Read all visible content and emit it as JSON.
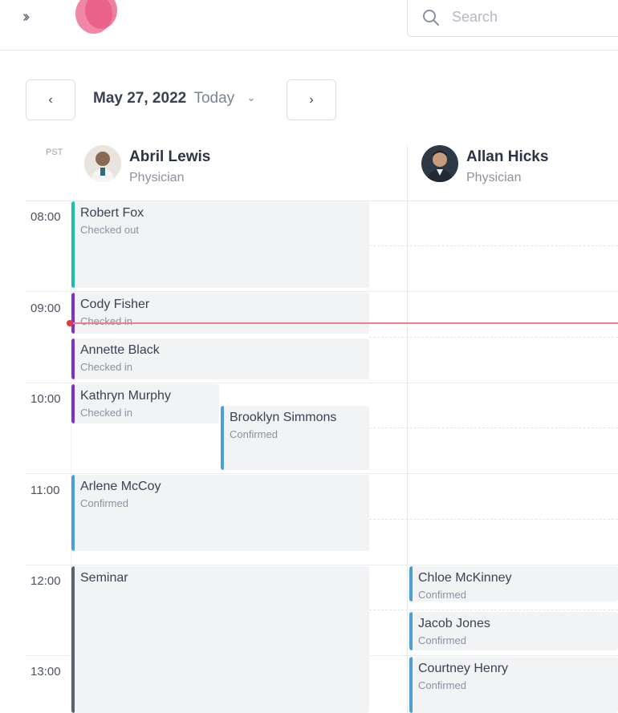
{
  "header": {
    "expand_icon": "double-chevron-right-icon",
    "search_placeholder": "Search"
  },
  "date_nav": {
    "prev_label": "‹",
    "next_label": "›",
    "date": "May 27, 2022",
    "today_label": "Today",
    "caret": "⌄"
  },
  "schedule": {
    "timezone": "PST",
    "time_labels": [
      "08:00",
      "09:00",
      "10:00",
      "11:00",
      "12:00",
      "13:00"
    ],
    "providers": [
      {
        "name": "Abril Lewis",
        "role": "Physician"
      },
      {
        "name": "Allan Hicks",
        "role": "Physician"
      }
    ],
    "events": [
      {
        "name": "Robert Fox",
        "status": "Checked out",
        "provider": "Abril Lewis",
        "color": "#1bbfa5"
      },
      {
        "name": "Cody Fisher",
        "status": "Checked in",
        "provider": "Abril Lewis",
        "color": "#7b35c4"
      },
      {
        "name": "Annette Black",
        "status": "Checked in",
        "provider": "Abril Lewis",
        "color": "#7b35c4"
      },
      {
        "name": "Kathryn Murphy",
        "status": "Checked in",
        "provider": "Abril Lewis",
        "color": "#7b35c4"
      },
      {
        "name": "Brooklyn Simmons",
        "status": "Confirmed",
        "provider": "Abril Lewis",
        "color": "#4a9fd8"
      },
      {
        "name": "Arlene McCoy",
        "status": "Confirmed",
        "provider": "Abril Lewis",
        "color": "#4a9fd8"
      },
      {
        "name": "Seminar",
        "status": "",
        "provider": "Abril Lewis",
        "color": "#596273"
      },
      {
        "name": "Chloe McKinney",
        "status": "Confirmed",
        "provider": "Allan Hicks",
        "color": "#4a9fd8"
      },
      {
        "name": "Jacob Jones",
        "status": "Confirmed",
        "provider": "Allan Hicks",
        "color": "#4a9fd8"
      },
      {
        "name": "Courtney Henry",
        "status": "Confirmed",
        "provider": "Allan Hicks",
        "color": "#4a9fd8"
      }
    ]
  },
  "colors": {
    "checked_out": "#1bbfa5",
    "checked_in": "#7b35c4",
    "confirmed": "#4a9fd8",
    "seminar": "#596273",
    "current_time": "#e53945"
  }
}
